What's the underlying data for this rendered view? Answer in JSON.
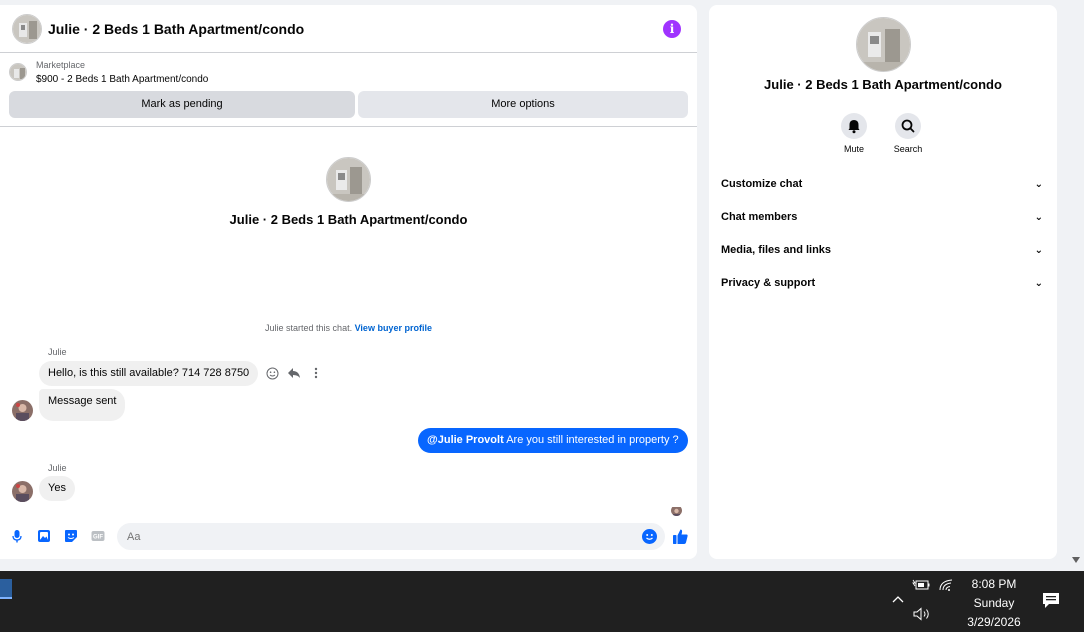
{
  "chat": {
    "title": "Julie · 2 Beds 1 Bath Apartment/condo",
    "info_glyph": "i"
  },
  "marketplace": {
    "label": "Marketplace",
    "listing": "$900 - 2 Beds 1 Bath Apartment/condo",
    "pending_label": "Mark as pending",
    "more_label": "More options"
  },
  "thread": {
    "title": "Julie · 2 Beds 1 Bath Apartment/condo",
    "started_text": "Julie started this chat.",
    "buyer_link": "View buyer profile",
    "messages": [
      {
        "sender": "Julie",
        "text": "Hello, is this still available? 714 728 8750"
      },
      {
        "text": "Message sent"
      },
      {
        "mention": "@Julie Provolt",
        "text": "Are you still interested in property ?"
      },
      {
        "sender": "Julie",
        "text": "Yes"
      }
    ]
  },
  "composer": {
    "placeholder": "Aa",
    "icons": [
      "microphone-icon",
      "photo-icon",
      "sticker-icon",
      "gif-icon",
      "emoji-icon",
      "thumbs-up-icon"
    ],
    "gif_text": "GIF"
  },
  "side": {
    "title": "Julie · 2 Beds 1 Bath Apartment/condo",
    "mute_label": "Mute",
    "search_label": "Search",
    "sections": [
      "Customize chat",
      "Chat members",
      "Media, files and links",
      "Privacy & support"
    ]
  },
  "taskbar": {
    "time": "8:08 PM",
    "day": "Sunday",
    "date": "3/29/2026"
  },
  "colors": {
    "accent": "#0866ff",
    "info": "#a033ff",
    "taskbar": "#202020"
  }
}
